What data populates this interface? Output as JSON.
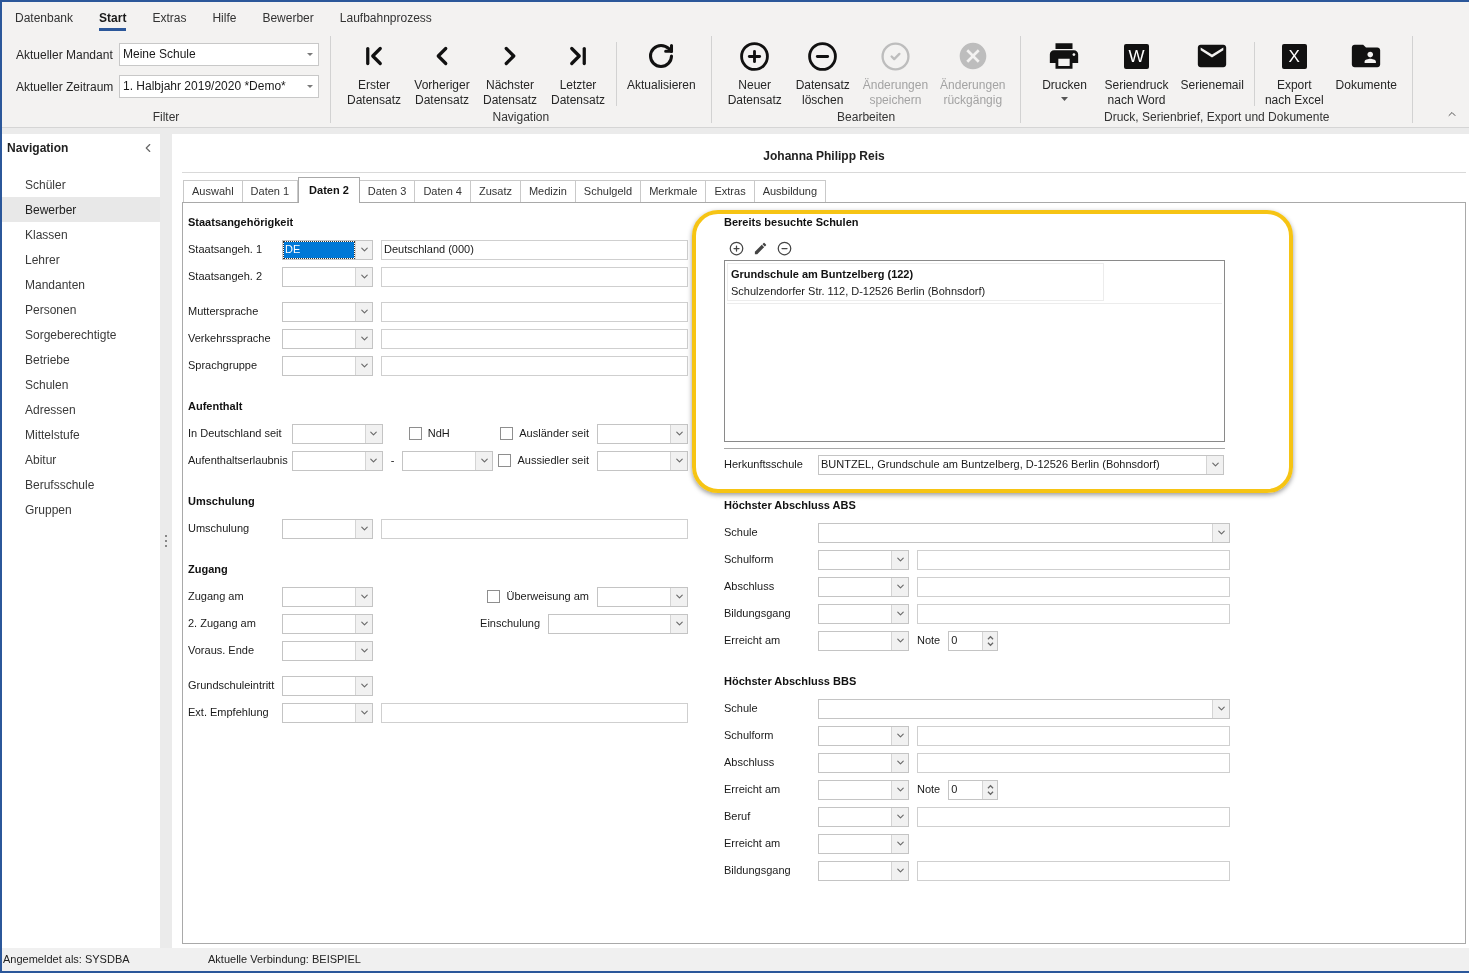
{
  "ribbon": {
    "menu_tabs": [
      {
        "label": "Datenbank",
        "selected": false
      },
      {
        "label": "Start",
        "selected": true
      },
      {
        "label": "Extras",
        "selected": false
      },
      {
        "label": "Hilfe",
        "selected": false
      },
      {
        "label": "Bewerber",
        "selected": false
      },
      {
        "label": "Laufbahnprozess",
        "selected": false
      }
    ],
    "filter": {
      "label": "Filter",
      "fields": [
        {
          "label": "Aktueller Mandant",
          "value": "Meine Schule"
        },
        {
          "label": "Aktueller Zeitraum",
          "value": "1. Halbjahr 2019/2020 *Demo*"
        }
      ]
    },
    "groups": [
      {
        "label": "Navigation",
        "button_sets": [
          [
            {
              "kind": "first",
              "lines": [
                "Erster",
                "Datensatz"
              ],
              "disabled": false,
              "dropdown": false
            },
            {
              "kind": "previous",
              "lines": [
                "Vorheriger",
                "Datensatz"
              ],
              "disabled": false,
              "dropdown": false
            },
            {
              "kind": "next",
              "lines": [
                "Nächster",
                "Datensatz"
              ],
              "disabled": false,
              "dropdown": false
            },
            {
              "kind": "last",
              "lines": [
                "Letzter",
                "Datensatz"
              ],
              "disabled": false,
              "dropdown": false
            }
          ],
          [
            {
              "kind": "refresh",
              "lines": [
                "Aktualisieren"
              ],
              "disabled": false,
              "dropdown": false
            }
          ]
        ]
      },
      {
        "label": "Bearbeiten",
        "button_sets": [
          [
            {
              "kind": "add",
              "lines": [
                "Neuer",
                "Datensatz"
              ],
              "disabled": false,
              "dropdown": false
            },
            {
              "kind": "delete",
              "lines": [
                "Datensatz",
                "löschen"
              ],
              "disabled": false,
              "dropdown": false
            },
            {
              "kind": "save",
              "lines": [
                "Änderungen",
                "speichern"
              ],
              "disabled": true,
              "dropdown": false
            },
            {
              "kind": "undo",
              "lines": [
                "Änderungen",
                "rückgängig"
              ],
              "disabled": true,
              "dropdown": false
            }
          ]
        ]
      },
      {
        "label": "Druck, Serienbrief, Export und Dokumente",
        "button_sets": [
          [
            {
              "kind": "print",
              "lines": [
                "Drucken"
              ],
              "disabled": false,
              "dropdown": true
            },
            {
              "kind": "tile",
              "glyph": "W",
              "lines": [
                "Seriendruck",
                "nach Word"
              ],
              "disabled": false,
              "dropdown": false
            },
            {
              "kind": "email",
              "lines": [
                "Serienemail"
              ],
              "disabled": false,
              "dropdown": false
            }
          ],
          [
            {
              "kind": "tile",
              "glyph": "X",
              "lines": [
                "Export",
                "nach Excel"
              ],
              "disabled": false,
              "dropdown": false
            },
            {
              "kind": "documents",
              "lines": [
                "Dokumente"
              ],
              "disabled": false,
              "dropdown": false
            }
          ]
        ]
      }
    ]
  },
  "navigation": {
    "title": "Navigation",
    "items": [
      {
        "label": "Schüler",
        "selected": false
      },
      {
        "label": "Bewerber",
        "selected": true
      },
      {
        "label": "Klassen",
        "selected": false
      },
      {
        "label": "Lehrer",
        "selected": false
      },
      {
        "label": "Mandanten",
        "selected": false
      },
      {
        "label": "Personen",
        "selected": false
      },
      {
        "label": "Sorgeberechtigte",
        "selected": false
      },
      {
        "label": "Betriebe",
        "selected": false
      },
      {
        "label": "Schulen",
        "selected": false
      },
      {
        "label": "Adressen",
        "selected": false
      },
      {
        "label": "Mittelstufe",
        "selected": false
      },
      {
        "label": "Abitur",
        "selected": false
      },
      {
        "label": "Berufsschule",
        "selected": false
      },
      {
        "label": "Gruppen",
        "selected": false
      }
    ]
  },
  "record_title": "Johanna Philipp Reis",
  "tabs": [
    {
      "label": "Auswahl",
      "selected": false
    },
    {
      "label": "Daten 1",
      "selected": false
    },
    {
      "label": "Daten 2",
      "selected": true
    },
    {
      "label": "Daten 3",
      "selected": false
    },
    {
      "label": "Daten 4",
      "selected": false
    },
    {
      "label": "Zusatz",
      "selected": false
    },
    {
      "label": "Medizin",
      "selected": false
    },
    {
      "label": "Schulgeld",
      "selected": false
    },
    {
      "label": "Merkmale",
      "selected": false
    },
    {
      "label": "Extras",
      "selected": false
    },
    {
      "label": "Ausbildung",
      "selected": false
    }
  ],
  "form": {
    "left_sections": [
      {
        "title": "Staatsangehörigkeit",
        "row_groups": [
          [
            {
              "label": "Staatsangeh. 1",
              "controls": [
                {
                  "kind": "combo",
                  "value": "DE",
                  "focused": true
                },
                {
                  "kind": "field",
                  "value": "Deutschland (000)"
                }
              ]
            },
            {
              "label": "Staatsangeh. 2",
              "controls": [
                {
                  "kind": "combo"
                },
                {
                  "kind": "field"
                }
              ]
            }
          ],
          [
            {
              "label": "Muttersprache",
              "controls": [
                {
                  "kind": "combo"
                },
                {
                  "kind": "field"
                }
              ]
            },
            {
              "label": "Verkehrssprache",
              "controls": [
                {
                  "kind": "combo"
                },
                {
                  "kind": "field"
                }
              ]
            },
            {
              "label": "Sprachgruppe",
              "controls": [
                {
                  "kind": "combo"
                },
                {
                  "kind": "field"
                }
              ]
            }
          ]
        ]
      },
      {
        "title": "Aufenthalt",
        "row_groups": [
          [
            {
              "label": "In Deutschland seit",
              "controls": [
                {
                  "kind": "combo"
                },
                {
                  "kind": "checkbox",
                  "label": "NdH",
                  "checked": false
                }
              ],
              "right_controls": [
                {
                  "kind": "checkbox",
                  "label": "Ausländer seit",
                  "checked": false
                },
                {
                  "kind": "combo"
                }
              ]
            },
            {
              "label": "Aufenthaltserlaubnis",
              "controls": [
                {
                  "kind": "combo"
                },
                {
                  "kind": "caption",
                  "text": "-"
                },
                {
                  "kind": "combo"
                }
              ],
              "right_controls": [
                {
                  "kind": "checkbox",
                  "label": "Aussiedler seit",
                  "checked": false
                },
                {
                  "kind": "combo"
                }
              ]
            }
          ]
        ]
      },
      {
        "title": "Umschulung",
        "row_groups": [
          [
            {
              "label": "Umschulung",
              "controls": [
                {
                  "kind": "combo"
                },
                {
                  "kind": "field"
                }
              ]
            }
          ]
        ]
      },
      {
        "title": "Zugang",
        "row_groups": [
          [
            {
              "label": "Zugang am",
              "controls": [
                {
                  "kind": "combo"
                }
              ],
              "right_controls": [
                {
                  "kind": "checkbox",
                  "label": "Überweisung am",
                  "checked": false
                },
                {
                  "kind": "combo"
                }
              ]
            },
            {
              "label": "2. Zugang am",
              "controls": [
                {
                  "kind": "combo"
                }
              ],
              "right_controls": [
                {
                  "kind": "caption",
                  "text": "Einschulung"
                },
                {
                  "kind": "longcombo"
                }
              ]
            },
            {
              "label": "Voraus. Ende",
              "controls": [
                {
                  "kind": "combo"
                }
              ]
            }
          ],
          [
            {
              "label": "Grundschuleintritt",
              "controls": [
                {
                  "kind": "combo"
                }
              ]
            },
            {
              "label": "Ext. Empfehlung",
              "controls": [
                {
                  "kind": "combo"
                },
                {
                  "kind": "field"
                }
              ]
            }
          ]
        ]
      }
    ],
    "schools": {
      "title": "Bereits besuchte Schulen",
      "highlighted": true,
      "entries": [
        {
          "name": "Grundschule am Buntzelberg (122)",
          "address": "Schulzendorfer Str. 112, D-12526 Berlin (Bohnsdorf)"
        }
      ],
      "origin": {
        "label": "Herkunftsschule",
        "controls": [
          {
            "kind": "longcombo",
            "value": "BUNTZEL, Grundschule am Buntzelberg, D-12526 Berlin (Bohnsdorf)",
            "focused": false
          }
        ]
      }
    },
    "right_sections": [
      {
        "title": "Höchster Abschluss ABS",
        "row_groups": [
          [
            {
              "label": "Schule",
              "controls": [
                {
                  "kind": "longcombo"
                }
              ]
            },
            {
              "label": "Schulform",
              "controls": [
                {
                  "kind": "combo"
                },
                {
                  "kind": "field"
                }
              ]
            },
            {
              "label": "Abschluss",
              "controls": [
                {
                  "kind": "combo"
                },
                {
                  "kind": "field"
                }
              ]
            },
            {
              "label": "Bildungsgang",
              "controls": [
                {
                  "kind": "combo"
                },
                {
                  "kind": "field"
                }
              ]
            },
            {
              "label": "Erreicht am",
              "controls": [
                {
                  "kind": "combo"
                },
                {
                  "kind": "caption",
                  "text": "Note"
                },
                {
                  "kind": "spin",
                  "value": "0"
                }
              ]
            }
          ]
        ]
      },
      {
        "title": "Höchster Abschluss BBS",
        "row_groups": [
          [
            {
              "label": "Schule",
              "controls": [
                {
                  "kind": "longcombo"
                }
              ]
            },
            {
              "label": "Schulform",
              "controls": [
                {
                  "kind": "combo"
                },
                {
                  "kind": "field"
                }
              ]
            },
            {
              "label": "Abschluss",
              "controls": [
                {
                  "kind": "combo"
                },
                {
                  "kind": "field"
                }
              ]
            },
            {
              "label": "Erreicht am",
              "controls": [
                {
                  "kind": "combo"
                },
                {
                  "kind": "caption",
                  "text": "Note"
                },
                {
                  "kind": "spin",
                  "value": "0"
                }
              ]
            },
            {
              "label": "Beruf",
              "controls": [
                {
                  "kind": "combo"
                },
                {
                  "kind": "field"
                }
              ]
            },
            {
              "label": "Erreicht am",
              "controls": [
                {
                  "kind": "combo"
                }
              ]
            },
            {
              "label": "Bildungsgang",
              "controls": [
                {
                  "kind": "combo"
                },
                {
                  "kind": "field"
                }
              ]
            }
          ]
        ]
      }
    ]
  },
  "status_bar": {
    "user": "Angemeldet als: SYSDBA",
    "connection": "Aktuelle Verbindung: BEISPIEL"
  }
}
